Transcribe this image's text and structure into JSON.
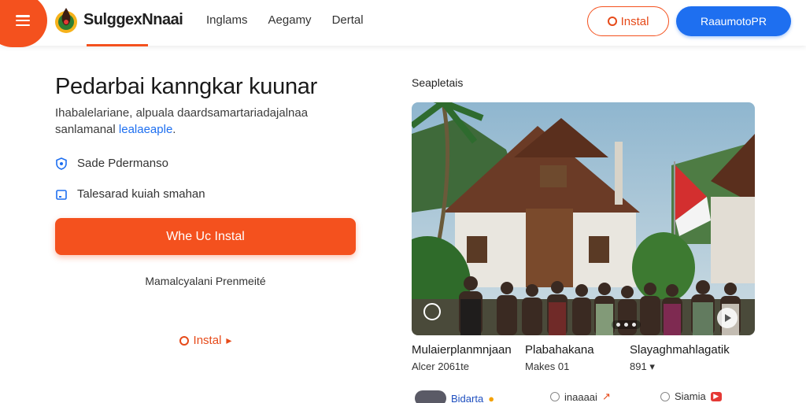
{
  "header": {
    "brand": "SulggexNnaai",
    "nav": [
      "Inglams",
      "Aegamy",
      "Dertal"
    ],
    "install_button": "Instal",
    "primary_button": "RaaumotoPR"
  },
  "hero": {
    "title": "Pedarbai kanngkar kuunar",
    "desc_line1": "Ihabalelariane, alpuala daardsamartariadajalnaa",
    "desc_line2_prefix": "sanlamanal",
    "desc_line2_link": "lealaeaple",
    "features": [
      {
        "label": "Sade Pdermanso",
        "icon": "shield-icon"
      },
      {
        "label": "Talesarad kuiah smahan",
        "icon": "calendar-icon"
      }
    ],
    "cta": "Whe Uc Instal",
    "note": "Mamalcyalani Prenmeité",
    "install_link": "Instal"
  },
  "gallery": {
    "label": "Seapletais",
    "cards": [
      {
        "title": "Mulaierplanmnjaan",
        "sub": "Alcer 2061te"
      },
      {
        "title": "Plabahakana",
        "sub": "Makes 01"
      },
      {
        "title": "Slayaghmahlagatik",
        "sub": "891"
      }
    ],
    "footer": [
      {
        "label": "Bidarta"
      },
      {
        "label": "inaaaai"
      },
      {
        "label": "Siamia"
      }
    ]
  },
  "colors": {
    "accent": "#f4511e",
    "primary": "#1e6ff0"
  }
}
